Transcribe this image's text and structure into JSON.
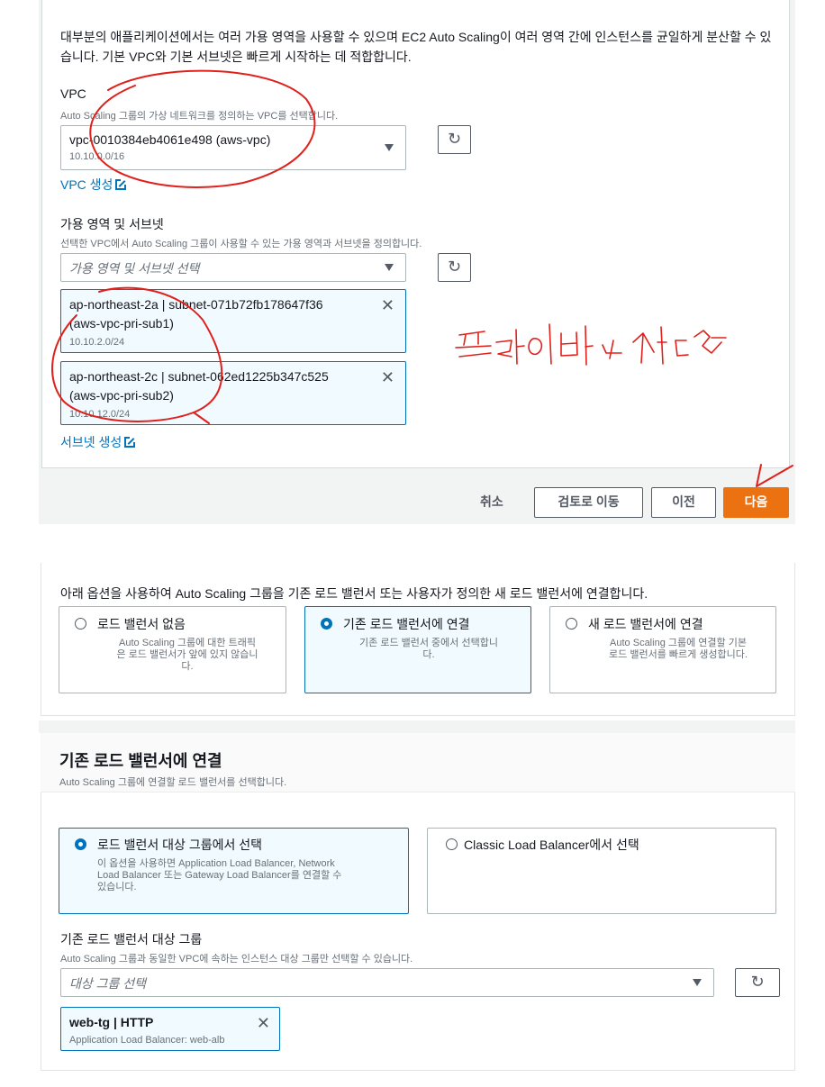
{
  "network": {
    "intro": "대부분의 애플리케이션에서는 여러 가용 영역을 사용할 수 있으며 EC2 Auto Scaling이 여러 영역 간에 인스턴스를 균일하게 분산할 수 있습니다. 기본 VPC와 기본 서브넷은 빠르게 시작하는 데 적합합니다.",
    "vpc": {
      "label": "VPC",
      "description": "Auto Scaling 그룹의 가상 네트워크를 정의하는 VPC를 선택합니다.",
      "selected_value": "vpc-0010384eb4061e498 (aws-vpc)",
      "selected_cidr": "10.10.0.0/16",
      "create_link": "VPC 생성"
    },
    "az": {
      "label": "가용 영역 및 서브넷",
      "description": "선택한 VPC에서 Auto Scaling 그룹이 사용할 수 있는 가용 영역과 서브넷을 정의합니다.",
      "placeholder": "가용 영역 및 서브넷 선택",
      "tokens": [
        {
          "line1": "ap-northeast-2a | subnet-071b72fb178647f36",
          "line2": "(aws-vpc-pri-sub1)",
          "cidr": "10.10.2.0/24"
        },
        {
          "line1": "ap-northeast-2c | subnet-062ed1225b347c525",
          "line2": "(aws-vpc-pri-sub2)",
          "cidr": "10.10.12.0/24"
        }
      ],
      "create_subnet_link": "서브넷 생성"
    }
  },
  "footer": {
    "cancel": "취소",
    "review": "검토로 이동",
    "previous": "이전",
    "next": "다음"
  },
  "load_balancing": {
    "intro": "아래 옵션을 사용하여 Auto Scaling 그룹을 기존 로드 밸런서 또는 사용자가 정의한 새 로드 밸런서에 연결합니다.",
    "options": [
      {
        "title": "로드 밸런서 없음",
        "desc": [
          "Auto Scaling 그룹에 대한 트래픽",
          "은 로드 밸런서가 앞에 있지 않습니",
          "다."
        ],
        "selected": false
      },
      {
        "title": "기존 로드 밸런서에 연결",
        "desc": [
          "기존 로드 밸런서 중에서 선택합니",
          "다."
        ],
        "selected": true
      },
      {
        "title": "새 로드 밸런서에 연결",
        "desc": [
          "Auto Scaling 그룹에 연결할 기본",
          "로드 밸런서를 빠르게 생성합니다."
        ],
        "selected": false
      }
    ]
  },
  "attach_existing": {
    "title": "기존 로드 밸런서에 연결",
    "subtitle": "Auto Scaling 그룹에 연결할 로드 밸런서를 선택합니다.",
    "options": [
      {
        "title": "로드 밸런서 대상 그룹에서 선택",
        "desc": [
          "이 옵션을 사용하면 Application Load Balancer, Network",
          "Load Balancer 또는 Gateway Load Balancer를 연결할 수",
          "있습니다."
        ],
        "selected": true
      },
      {
        "title": "Classic Load Balancer에서 선택",
        "desc": [],
        "selected": false
      }
    ],
    "target_group": {
      "label": "기존 로드 밸런서 대상 그룹",
      "description": "Auto Scaling 그룹과 동일한 VPC에 속하는 인스턴스 대상 그룹만 선택할 수 있습니다.",
      "placeholder": "대상 그룹 선택",
      "token_title": "web-tg | HTTP",
      "token_desc": "Application Load Balancer: web-alb"
    }
  },
  "handwriting": {
    "note": "프라이빗 선택"
  },
  "colors": {
    "accent": "#0073bb",
    "primary_button": "#ec7211",
    "annotation_ink": "#e0201b"
  }
}
